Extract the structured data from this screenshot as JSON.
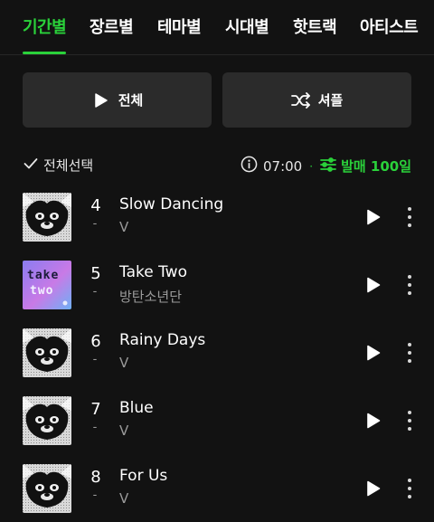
{
  "tabs": [
    {
      "label": "기간별",
      "active": true
    },
    {
      "label": "장르별",
      "active": false
    },
    {
      "label": "테마별",
      "active": false
    },
    {
      "label": "시대별",
      "active": false
    },
    {
      "label": "핫트랙",
      "active": false
    },
    {
      "label": "아티스트",
      "active": false
    }
  ],
  "actions": {
    "play_all_label": "전체",
    "shuffle_label": "셔플"
  },
  "list_header": {
    "select_all_label": "전체선택",
    "time": "07:00",
    "filter_label": "발매 100일"
  },
  "tracks": [
    {
      "rank": "4",
      "change": "-",
      "title": "Slow Dancing",
      "artist": "V",
      "cover": "dog-photo-cover"
    },
    {
      "rank": "5",
      "change": "-",
      "title": "Take Two",
      "artist": "방탄소년단",
      "cover": "take-two-cover",
      "cover_text": "take two"
    },
    {
      "rank": "6",
      "change": "-",
      "title": "Rainy Days",
      "artist": "V",
      "cover": "dog-photo-cover"
    },
    {
      "rank": "7",
      "change": "-",
      "title": "Blue",
      "artist": "V",
      "cover": "dog-photo-cover"
    },
    {
      "rank": "8",
      "change": "-",
      "title": "For Us",
      "artist": "V",
      "cover": "dog-photo-cover"
    }
  ],
  "colors": {
    "accent": "#2ad13a",
    "background": "#121212",
    "button_bg": "#2b2b2b",
    "secondary_text": "#9a9a9a"
  }
}
